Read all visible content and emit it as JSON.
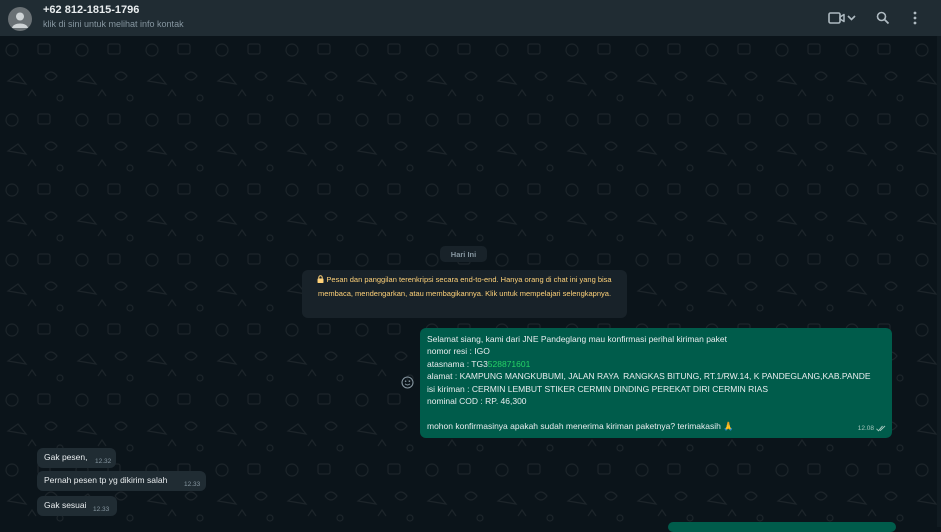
{
  "header": {
    "contact_name": "+62 812-1815-1796",
    "contact_subtitle": "klik di sini untuk melihat info kontak",
    "icons": [
      "avatar-person-icon",
      "video-call-icon",
      "chevron-down-icon",
      "search-icon",
      "menu-kebab-icon"
    ]
  },
  "chat": {
    "date_label": "Hari Ini",
    "encryption_notice": "Pesan dan panggilan terenkripsi secara end-to-end. Hanya orang di chat ini yang bisa membaca, mendengarkan, atau membagikannya. Klik untuk mempelajari selengkapnya.",
    "outgoing": {
      "line1": "Selamat siang, kami dari JNE Pandeglang mau konfirmasi perihal kiriman paket",
      "line2": "nomor resi : IGO",
      "line3_prefix": "atasnama : TG3",
      "line3_highlight": "528871601",
      "line4": "alamat : KAMPUNG MANGKUBUMI, JALAN RAYA  RANGKAS BITUNG, RT.1/RW.14, K PANDEGLANG,KAB.PANDE",
      "line5": "isi kiriman : CERMIN LEMBUT STIKER CERMIN DINDING PEREKAT DIRI CERMIN RIAS",
      "line6": "nominal COD : RP. 46,300",
      "line7": "mohon konfirmasinya apakah sudah menerima kiriman paketnya? terimakasih 🙏",
      "time": "12.08"
    },
    "incoming": [
      {
        "text": "Gak pesen,",
        "time": "12.32"
      },
      {
        "text": "Pernah pesen tp yg dikirim salah",
        "time": "12.33"
      },
      {
        "text": "Gak sesuai",
        "time": "12.33"
      }
    ]
  },
  "colors": {
    "background": "#0b141a",
    "header": "#202c33",
    "outgoing_bubble": "#005c4b",
    "incoming_bubble": "#202c33",
    "notice_text": "#ffd279"
  }
}
